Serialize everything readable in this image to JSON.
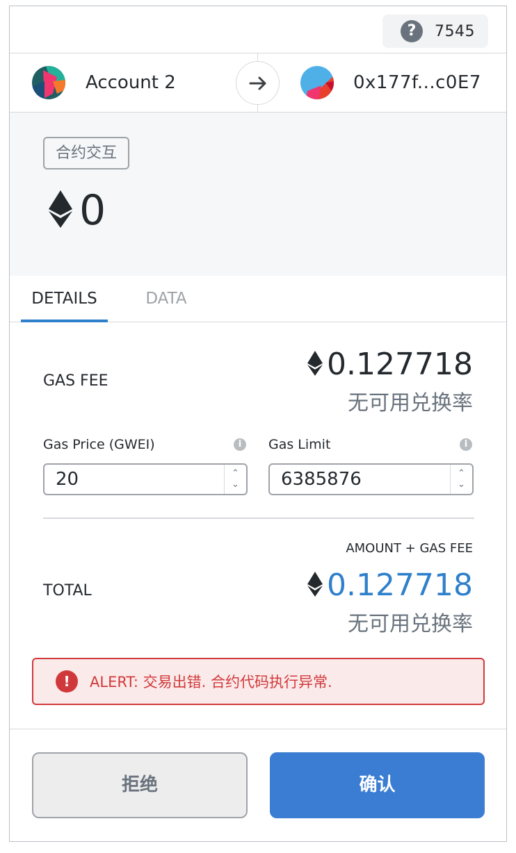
{
  "header": {
    "help_icon": "question-circle-icon",
    "help_glyph": "?",
    "network_label": "7545"
  },
  "sender": {
    "from_name": "Account 2",
    "to_address": "0x177f...c0E7",
    "arrow_icon": "arrow-right-icon"
  },
  "summary": {
    "method": "合约交互",
    "amount": "0",
    "currency_icon": "ethereum-icon"
  },
  "tabs": [
    {
      "label": "DETAILS",
      "active": true
    },
    {
      "label": "DATA",
      "active": false
    }
  ],
  "gas": {
    "fee_label": "GAS FEE",
    "fee_value": "0.127718",
    "fee_fiat": "无可用兑换率",
    "price_label": "Gas Price (GWEI)",
    "price_value": "20",
    "limit_label": "Gas Limit",
    "limit_value": "6385876",
    "info_glyph": "i"
  },
  "total": {
    "caption": "AMOUNT + GAS FEE",
    "label": "TOTAL",
    "value": "0.127718",
    "fiat": "无可用兑换率"
  },
  "alert": {
    "glyph": "!",
    "text": "ALERT: 交易出错. 合约代码执行异常."
  },
  "footer": {
    "reject_label": "拒绝",
    "confirm_label": "确认"
  },
  "colors": {
    "accent": "#2f80cb",
    "confirm": "#3b7dd3",
    "alert": "#d0393b",
    "alert_bg": "#fbeaea"
  }
}
